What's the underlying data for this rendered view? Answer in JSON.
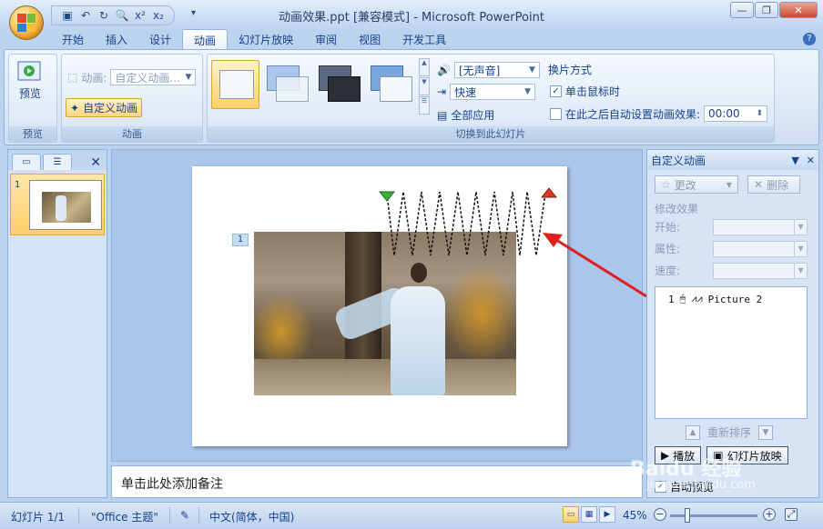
{
  "window": {
    "title": "动画效果.ppt [兼容模式] - Microsoft PowerPoint"
  },
  "ribbon": {
    "tabs": [
      "开始",
      "插入",
      "设计",
      "动画",
      "幻灯片放映",
      "审阅",
      "视图",
      "开发工具"
    ],
    "active_tab": "动画",
    "preview": {
      "button_label": "预览",
      "group_label": "预览"
    },
    "animations": {
      "animate_label": "动画:",
      "animate_value": "自定义动画...",
      "custom_animation_label": "自定义动画",
      "group_label": "动画"
    },
    "transition": {
      "sound_value": "[无声音]",
      "speed_value": "快速",
      "apply_all_label": "全部应用",
      "advance_heading": "换片方式",
      "on_click_label": "单击鼠标时",
      "on_click_checked": true,
      "auto_after_label": "在此之后自动设置动画效果:",
      "auto_after_checked": false,
      "auto_after_time": "00:00",
      "group_label": "切换到此幻灯片"
    }
  },
  "slides_panel": {
    "slide_number": "1"
  },
  "slide": {
    "animation_tag": "1"
  },
  "notes": {
    "placeholder": "单击此处添加备注"
  },
  "task_pane": {
    "title": "自定义动画",
    "change_label": "更改",
    "remove_label": "删除",
    "modify_heading": "修改效果",
    "start_label": "开始:",
    "property_label": "属性:",
    "speed_label": "速度:",
    "list_item": {
      "order": "1",
      "name": "Picture 2"
    },
    "reorder_label": "重新排序",
    "play_label": "播放",
    "slideshow_label": "幻灯片放映",
    "autopreview_label": "自动预览",
    "autopreview_checked": true
  },
  "status_bar": {
    "slide_info": "幻灯片 1/1",
    "theme": "\"Office 主题\"",
    "language": "中文(简体，中国)",
    "zoom": "45%"
  },
  "watermark": {
    "text": "Baidu 经验",
    "url": "jingyan.baidu.com"
  }
}
